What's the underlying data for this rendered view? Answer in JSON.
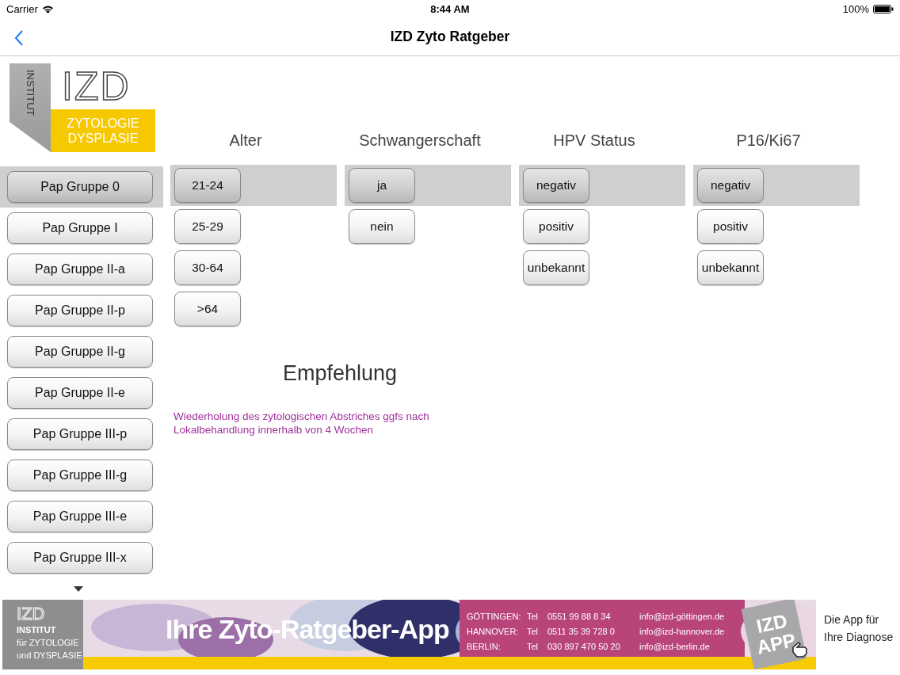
{
  "status_bar": {
    "carrier": "Carrier",
    "time": "8:44 AM",
    "battery": "100%"
  },
  "nav": {
    "title": "IZD Zyto Ratgeber"
  },
  "logo": {
    "vertical": "INSTITUT",
    "letters": "IZD",
    "line1": "ZYTOLOGIE",
    "line2": "DYSPLASIE"
  },
  "pap_groups": [
    {
      "label": "Pap Gruppe 0",
      "selected": true
    },
    {
      "label": "Pap Gruppe I",
      "selected": false
    },
    {
      "label": "Pap Gruppe II-a",
      "selected": false
    },
    {
      "label": "Pap Gruppe II-p",
      "selected": false
    },
    {
      "label": "Pap Gruppe II-g",
      "selected": false
    },
    {
      "label": "Pap Gruppe II-e",
      "selected": false
    },
    {
      "label": "Pap Gruppe III-p",
      "selected": false
    },
    {
      "label": "Pap Gruppe III-g",
      "selected": false
    },
    {
      "label": "Pap Gruppe III-e",
      "selected": false
    },
    {
      "label": "Pap Gruppe III-x",
      "selected": false
    }
  ],
  "columns": [
    {
      "title": "Alter",
      "options": [
        {
          "label": "21-24",
          "selected": true
        },
        {
          "label": "25-29",
          "selected": false
        },
        {
          "label": "30-64",
          "selected": false
        },
        {
          "label": ">64",
          "selected": false
        }
      ]
    },
    {
      "title": "Schwangerschaft",
      "options": [
        {
          "label": "ja",
          "selected": true
        },
        {
          "label": "nein",
          "selected": false
        }
      ]
    },
    {
      "title": "HPV Status",
      "options": [
        {
          "label": "negativ",
          "selected": true
        },
        {
          "label": "positiv",
          "selected": false
        },
        {
          "label": "unbekannt",
          "selected": false
        }
      ]
    },
    {
      "title": "P16/Ki67",
      "options": [
        {
          "label": "negativ",
          "selected": true
        },
        {
          "label": "positiv",
          "selected": false
        },
        {
          "label": "unbekannt",
          "selected": false
        }
      ]
    }
  ],
  "recommendation": {
    "title": "Empfehlung",
    "text": "Wiederholung des zytologischen Abstriches ggfs nach Lokalbehandlung innerhalb von 4 Wochen"
  },
  "banner": {
    "logo_letters": "IZD",
    "logo_lines": [
      "INSTITUT",
      "für ZYTOLOGIE",
      "und DYSPLASIE"
    ],
    "slogan": "Ihre Zyto-Ratgeber-App",
    "contacts": [
      {
        "city": "GÖTTINGEN:",
        "tel": "Tel",
        "number": "0551  99 88 8 34",
        "email": "info@izd-göttingen.de"
      },
      {
        "city": "HANNOVER:",
        "tel": "Tel",
        "number": "0511 35 39 728 0",
        "email": "info@izd-hannover.de"
      },
      {
        "city": "BERLIN:",
        "tel": "Tel",
        "number": "030 897 470 50 20",
        "email": "info@izd-berlin.de"
      }
    ],
    "badge_lines": [
      "IZD",
      "APP"
    ],
    "tagline": [
      "Die App für",
      "Ihre Diagnose"
    ]
  }
}
